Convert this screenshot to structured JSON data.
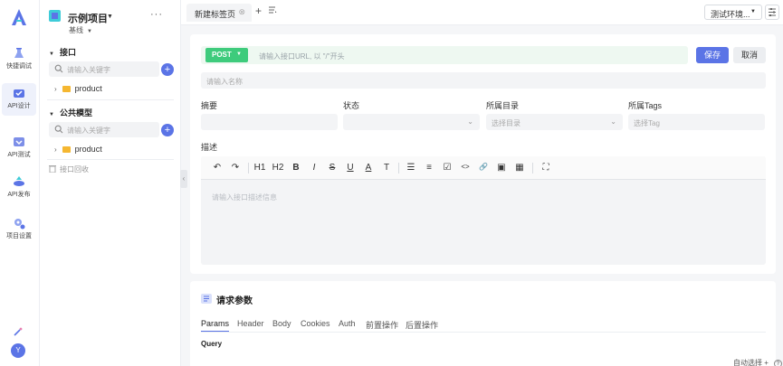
{
  "rail": {
    "items": [
      {
        "label": "快捷调试",
        "icon": "flask-icon"
      },
      {
        "label": "API设计",
        "icon": "api-design-icon"
      },
      {
        "label": "API测试",
        "icon": "api-test-icon"
      },
      {
        "label": "API发布",
        "icon": "api-publish-icon"
      },
      {
        "label": "项目设置",
        "icon": "settings-icon"
      }
    ],
    "active": "API设计",
    "avatar": "Y"
  },
  "project": {
    "name": "示例项目",
    "branch": "基线",
    "more": "···"
  },
  "tree": {
    "interface_section": "接口",
    "interface_search_placeholder": "请输入关键字",
    "interface_folder": "product",
    "model_section": "公共模型",
    "model_search_placeholder": "请输入关键字",
    "model_folder": "product",
    "recycle": "接口回收"
  },
  "tabs": {
    "active_label": "新建标签页",
    "add": "+",
    "environment": "测试环境..."
  },
  "editor_form": {
    "method": "POST",
    "url_placeholder": "请输入接口URL, 以 \"/\"开头",
    "save_label": "保存",
    "cancel_label": "取消",
    "name_placeholder": "请输入名称",
    "summary_label": "摘要",
    "status_label": "状态",
    "directory_label": "所属目录",
    "directory_placeholder": "选择目录",
    "tags_label": "所属Tags",
    "tags_placeholder": "选择Tag",
    "description_label": "描述",
    "description_placeholder": "请输入接口描述信息",
    "toolbar": {
      "undo": "↶",
      "redo": "↷",
      "h1": "H1",
      "h2": "H2",
      "bold": "B",
      "italic": "I",
      "strike": "S",
      "underline": "U",
      "font_color": "A",
      "font_size": "T",
      "bullet_list": "☰",
      "ordered_list": "≡",
      "task_list": "☑",
      "code": "<>",
      "link": "🔗",
      "image": "▣",
      "table": "▦",
      "fullscreen": "⛶"
    }
  },
  "params": {
    "title": "请求参数",
    "tabs": [
      "Params",
      "Header",
      "Body",
      "Cookies",
      "Auth",
      "前置操作",
      "后置操作"
    ],
    "active_tab": "Params",
    "query_label": "Query"
  },
  "footer": {
    "hint": "自动选择",
    "plus": "+",
    "help": "?"
  }
}
